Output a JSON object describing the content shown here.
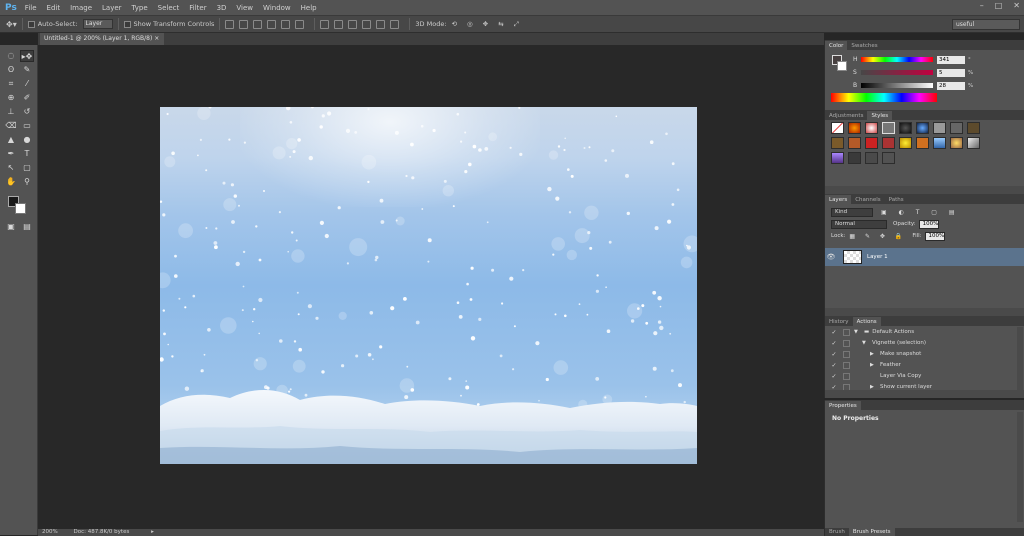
{
  "app": {
    "logo": "Ps",
    "menu": [
      "File",
      "Edit",
      "Image",
      "Layer",
      "Type",
      "Select",
      "Filter",
      "3D",
      "View",
      "Window",
      "Help"
    ],
    "window_controls": [
      "–",
      "□",
      "✕"
    ]
  },
  "options": {
    "auto_select_label": "Auto-Select:",
    "auto_select_value": "Layer",
    "transform_label": "Show Transform Controls",
    "mode_3d_label": "3D Mode:",
    "preset": "useful"
  },
  "document": {
    "tab_label": "Untitled-1 @ 200% (Layer 1, RGB/8)",
    "status_zoom": "200%",
    "status_doc": "Doc: 487.8K/0 bytes"
  },
  "color_panel": {
    "tabs": [
      "Color",
      "Swatches"
    ],
    "h_label": "H",
    "s_label": "S",
    "b_label": "B",
    "h": "341",
    "s": "5",
    "b": "28",
    "h_unit": "°",
    "s_unit": "%",
    "b_unit": "%"
  },
  "styles_panel": {
    "tabs": [
      "Adjustments",
      "Styles"
    ]
  },
  "layers_panel": {
    "tabs": [
      "Layers",
      "Channels",
      "Paths"
    ],
    "kind": "Kind",
    "blend_mode": "Normal",
    "opacity_label": "Opacity:",
    "opacity": "100%",
    "lock_label": "Lock:",
    "fill_label": "Fill:",
    "fill": "100%",
    "layers": [
      "Layer 1"
    ]
  },
  "actions_panel": {
    "tabs": [
      "History",
      "Actions"
    ],
    "items": [
      "Default Actions",
      "Vignette (selection)",
      "Make snapshot",
      "Feather",
      "Layer Via Copy",
      "Show current layer"
    ]
  },
  "properties_panel": {
    "tabs": [
      "Properties"
    ],
    "text": "No Properties"
  },
  "brush_panel": {
    "tabs": [
      "Brush",
      "Brush Presets"
    ]
  },
  "colors": {
    "accent": "#5b738d",
    "chrome": "#535353",
    "canvas": "#282828"
  }
}
